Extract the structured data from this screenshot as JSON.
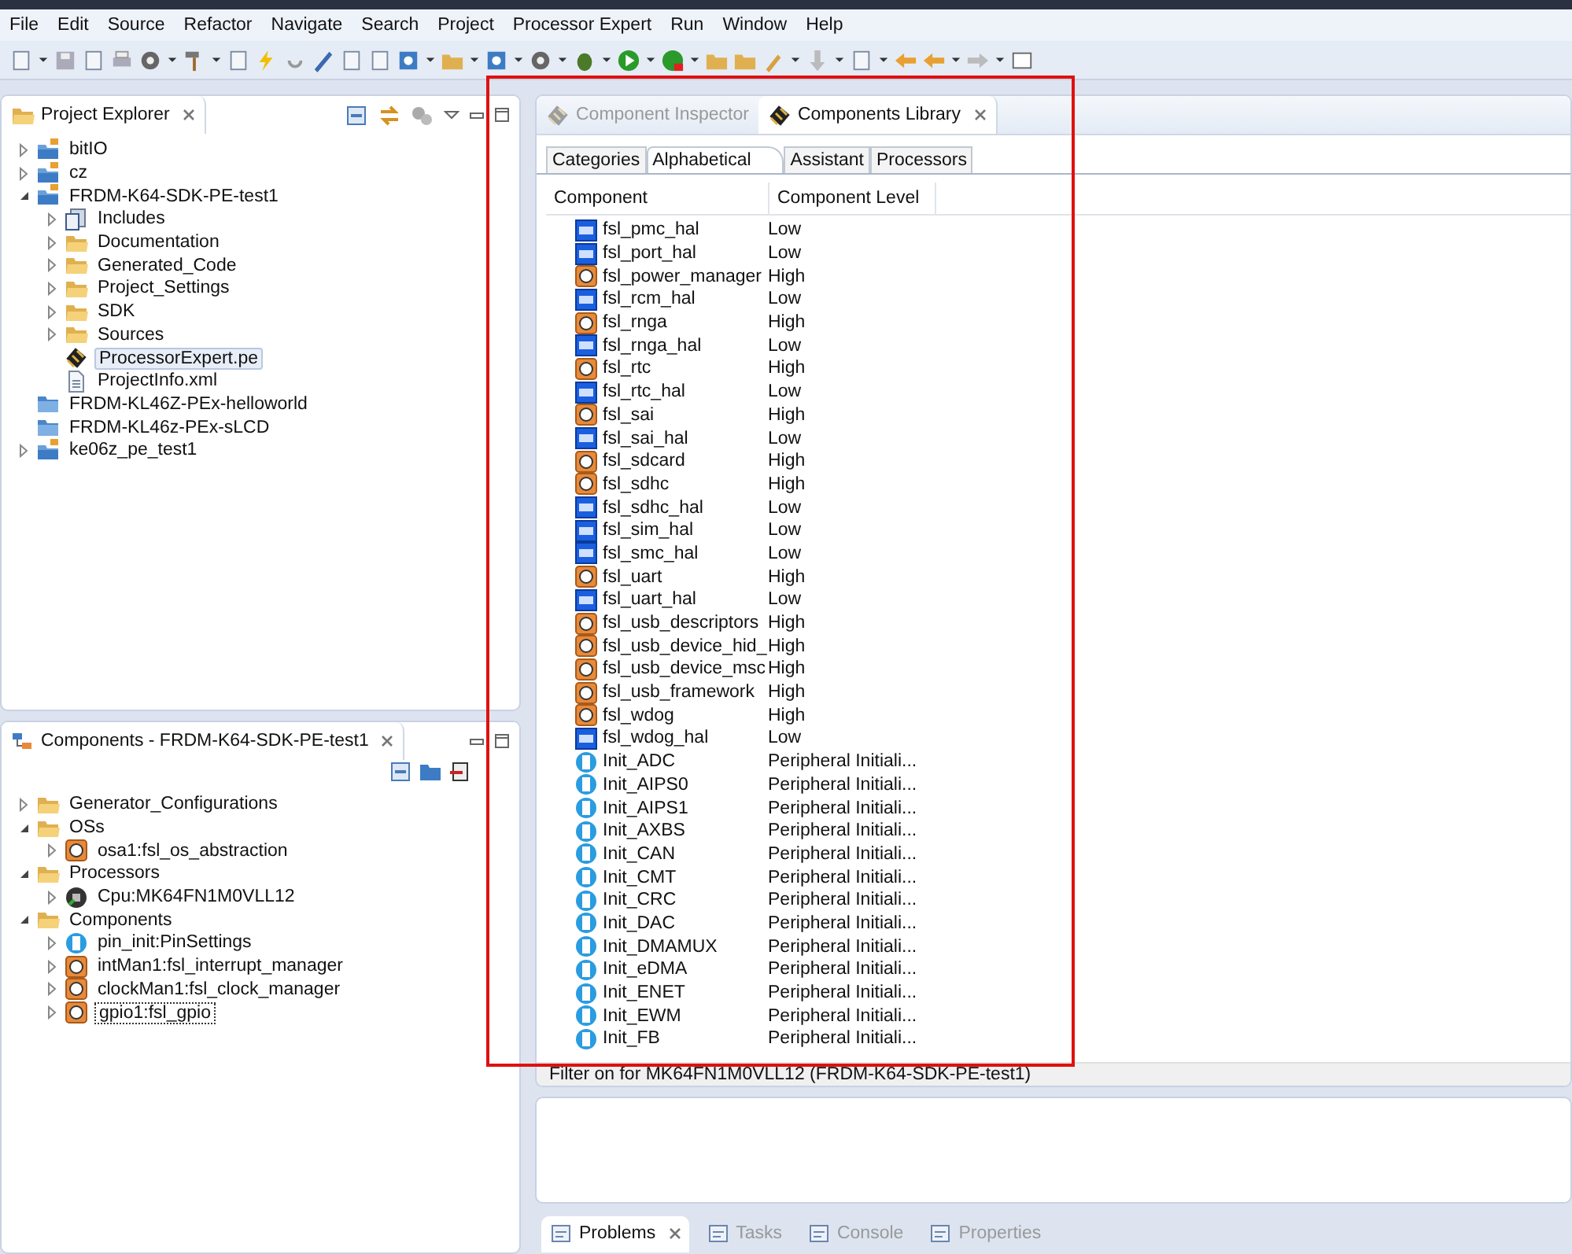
{
  "menu": [
    "File",
    "Edit",
    "Source",
    "Refactor",
    "Navigate",
    "Search",
    "Project",
    "Processor Expert",
    "Run",
    "Window",
    "Help"
  ],
  "project_explorer": {
    "title": "Project Explorer",
    "items": [
      {
        "label": "bitIO",
        "kind": "project",
        "expanded": false,
        "selected": false
      },
      {
        "label": "cz",
        "kind": "project",
        "expanded": false,
        "selected": false
      },
      {
        "label": "FRDM-K64-SDK-PE-test1",
        "kind": "project",
        "expanded": true,
        "selected": false,
        "children": [
          {
            "label": "Includes",
            "kind": "includes",
            "expanded": false,
            "selected": false
          },
          {
            "label": "Documentation",
            "kind": "folder",
            "expanded": false,
            "selected": false
          },
          {
            "label": "Generated_Code",
            "kind": "folder",
            "expanded": false,
            "selected": false
          },
          {
            "label": "Project_Settings",
            "kind": "folder",
            "expanded": false,
            "selected": false
          },
          {
            "label": "SDK",
            "kind": "folder",
            "expanded": false,
            "selected": false
          },
          {
            "label": "Sources",
            "kind": "folder",
            "expanded": false,
            "selected": false
          },
          {
            "label": "ProcessorExpert.pe",
            "kind": "chip",
            "selected": true
          },
          {
            "label": "ProjectInfo.xml",
            "kind": "file",
            "selected": false
          }
        ]
      },
      {
        "label": "FRDM-KL46Z-PEx-helloworld",
        "kind": "closed",
        "selected": false
      },
      {
        "label": "FRDM-KL46z-PEx-sLCD",
        "kind": "closed",
        "selected": false
      },
      {
        "label": "ke06z_pe_test1",
        "kind": "project",
        "expanded": false,
        "selected": false
      }
    ]
  },
  "components_view": {
    "title": "Components - FRDM-K64-SDK-PE-test1",
    "items": [
      {
        "label": "Generator_Configurations",
        "kind": "folder",
        "expanded": false,
        "selected": false
      },
      {
        "label": "OSs",
        "kind": "folder",
        "expanded": true,
        "selected": false,
        "children": [
          {
            "label": "osa1:fsl_os_abstraction",
            "kind": "driver",
            "expanded": false,
            "selected": false
          }
        ]
      },
      {
        "label": "Processors",
        "kind": "folder",
        "expanded": true,
        "selected": false,
        "children": [
          {
            "label": "Cpu:MK64FN1M0VLL12",
            "kind": "cpu",
            "expanded": false,
            "selected": false
          }
        ]
      },
      {
        "label": "Components",
        "kind": "folder",
        "expanded": true,
        "selected": false,
        "children": [
          {
            "label": "pin_init:PinSettings",
            "kind": "init",
            "expanded": false,
            "selected": false
          },
          {
            "label": "intMan1:fsl_interrupt_manager",
            "kind": "driver",
            "expanded": false,
            "selected": false
          },
          {
            "label": "clockMan1:fsl_clock_manager",
            "kind": "driver",
            "expanded": false,
            "selected": false
          },
          {
            "label": "gpio1:fsl_gpio",
            "kind": "driver",
            "expanded": false,
            "selected": true
          }
        ]
      }
    ]
  },
  "library": {
    "tabs": [
      {
        "label": "Component Inspector",
        "selected": false
      },
      {
        "label": "Components Library",
        "selected": true
      }
    ],
    "subtabs": [
      {
        "label": "Categories",
        "selected": false
      },
      {
        "label": "Alphabetical",
        "selected": true
      },
      {
        "label": "Assistant",
        "selected": false
      },
      {
        "label": "Processors",
        "selected": false
      }
    ],
    "columns": [
      "Component",
      "Component Level"
    ],
    "rows": [
      {
        "name": "fsl_pmc_hal",
        "level": "Low",
        "kind": "hal"
      },
      {
        "name": "fsl_port_hal",
        "level": "Low",
        "kind": "hal"
      },
      {
        "name": "fsl_power_manager",
        "level": "High",
        "kind": "driver"
      },
      {
        "name": "fsl_rcm_hal",
        "level": "Low",
        "kind": "hal"
      },
      {
        "name": "fsl_rnga",
        "level": "High",
        "kind": "driver"
      },
      {
        "name": "fsl_rnga_hal",
        "level": "Low",
        "kind": "hal"
      },
      {
        "name": "fsl_rtc",
        "level": "High",
        "kind": "driver"
      },
      {
        "name": "fsl_rtc_hal",
        "level": "Low",
        "kind": "hal"
      },
      {
        "name": "fsl_sai",
        "level": "High",
        "kind": "driver"
      },
      {
        "name": "fsl_sai_hal",
        "level": "Low",
        "kind": "hal"
      },
      {
        "name": "fsl_sdcard",
        "level": "High",
        "kind": "driver"
      },
      {
        "name": "fsl_sdhc",
        "level": "High",
        "kind": "driver"
      },
      {
        "name": "fsl_sdhc_hal",
        "level": "Low",
        "kind": "hal"
      },
      {
        "name": "fsl_sim_hal",
        "level": "Low",
        "kind": "hal"
      },
      {
        "name": "fsl_smc_hal",
        "level": "Low",
        "kind": "hal"
      },
      {
        "name": "fsl_uart",
        "level": "High",
        "kind": "driver"
      },
      {
        "name": "fsl_uart_hal",
        "level": "Low",
        "kind": "hal"
      },
      {
        "name": "fsl_usb_descriptors",
        "level": "High",
        "kind": "driver"
      },
      {
        "name": "fsl_usb_device_hid_",
        "level": "High",
        "kind": "driver"
      },
      {
        "name": "fsl_usb_device_msc",
        "level": "High",
        "kind": "driver"
      },
      {
        "name": "fsl_usb_framework",
        "level": "High",
        "kind": "driver"
      },
      {
        "name": "fsl_wdog",
        "level": "High",
        "kind": "driver"
      },
      {
        "name": "fsl_wdog_hal",
        "level": "Low",
        "kind": "hal"
      },
      {
        "name": "Init_ADC",
        "level": "Peripheral Initiali...",
        "kind": "init"
      },
      {
        "name": "Init_AIPS0",
        "level": "Peripheral Initiali...",
        "kind": "init"
      },
      {
        "name": "Init_AIPS1",
        "level": "Peripheral Initiali...",
        "kind": "init"
      },
      {
        "name": "Init_AXBS",
        "level": "Peripheral Initiali...",
        "kind": "init"
      },
      {
        "name": "Init_CAN",
        "level": "Peripheral Initiali...",
        "kind": "init"
      },
      {
        "name": "Init_CMT",
        "level": "Peripheral Initiali...",
        "kind": "init"
      },
      {
        "name": "Init_CRC",
        "level": "Peripheral Initiali...",
        "kind": "init"
      },
      {
        "name": "Init_DAC",
        "level": "Peripheral Initiali...",
        "kind": "init"
      },
      {
        "name": "Init_DMAMUX",
        "level": "Peripheral Initiali...",
        "kind": "init"
      },
      {
        "name": "Init_eDMA",
        "level": "Peripheral Initiali...",
        "kind": "init"
      },
      {
        "name": "Init_ENET",
        "level": "Peripheral Initiali...",
        "kind": "init"
      },
      {
        "name": "Init_EWM",
        "level": "Peripheral Initiali...",
        "kind": "init"
      },
      {
        "name": "Init_FB",
        "level": "Peripheral Initiali...",
        "kind": "init"
      }
    ],
    "filter": "Filter on for MK64FN1M0VLL12 (FRDM-K64-SDK-PE-test1)"
  },
  "bottom_tabs": [
    {
      "label": "Problems",
      "selected": true
    },
    {
      "label": "Tasks",
      "selected": false
    },
    {
      "label": "Console",
      "selected": false
    },
    {
      "label": "Properties",
      "selected": false
    }
  ]
}
